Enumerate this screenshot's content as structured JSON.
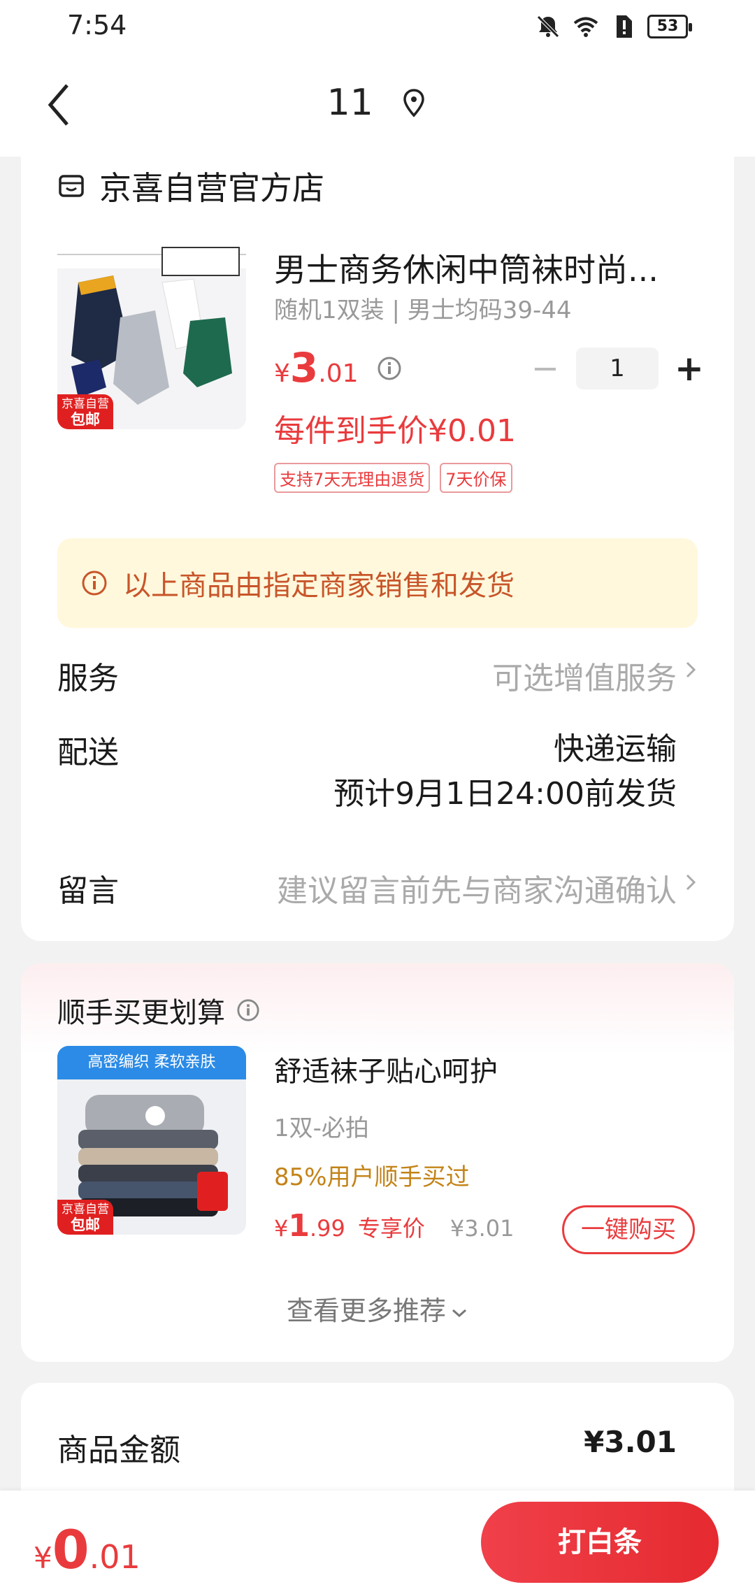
{
  "status_bar": {
    "time": "7:54",
    "battery": "53"
  },
  "nav": {
    "title": "11"
  },
  "shop": {
    "name": "京喜自营官方店"
  },
  "product": {
    "title": "男士商务休闲中筒袜时尚...",
    "spec": "随机1双装 | 男士均码39-44",
    "price": {
      "symbol": "¥",
      "int": "3",
      "dec": ".01"
    },
    "quantity": "1",
    "unit_price": "每件到手价¥0.01",
    "tags": [
      "支持7天无理由退货",
      "7天价保"
    ],
    "badge": {
      "line1": "京喜自营",
      "line2": "包邮"
    }
  },
  "notice": {
    "text": "以上商品由指定商家销售和发货"
  },
  "rows": {
    "service": {
      "label": "服务",
      "value": "可选增值服务"
    },
    "delivery": {
      "label": "配送",
      "value_line1": "快递运输",
      "value_line2": "预计9月1日24:00前发货"
    },
    "note": {
      "label": "留言",
      "placeholder": "建议留言前先与商家沟通确认"
    }
  },
  "recommend": {
    "title": "顺手买更划算",
    "banner": "高密编织 柔软亲肤",
    "badge": {
      "line1": "京喜自营",
      "line2": "包邮"
    },
    "name": "舒适袜子贴心呵护",
    "spec": "1双-必拍",
    "social": "85%用户顺手买过",
    "price": {
      "symbol": "¥",
      "int": "1",
      "dec": ".99"
    },
    "price_label": "专享价",
    "orig_price": "¥3.01",
    "buy_label": "一键购买",
    "more_label": "查看更多推荐"
  },
  "summary": {
    "amount_label": "商品金额",
    "amount_value": "¥3.01"
  },
  "bottom": {
    "total": {
      "symbol": "¥",
      "int": "0",
      "dec": ".01"
    },
    "pay_label": "打白条"
  },
  "colors": {
    "accent": "#e93b3d",
    "notice_bg": "#fff8dc",
    "notice_text": "#c8552a",
    "social": "#c38318"
  }
}
